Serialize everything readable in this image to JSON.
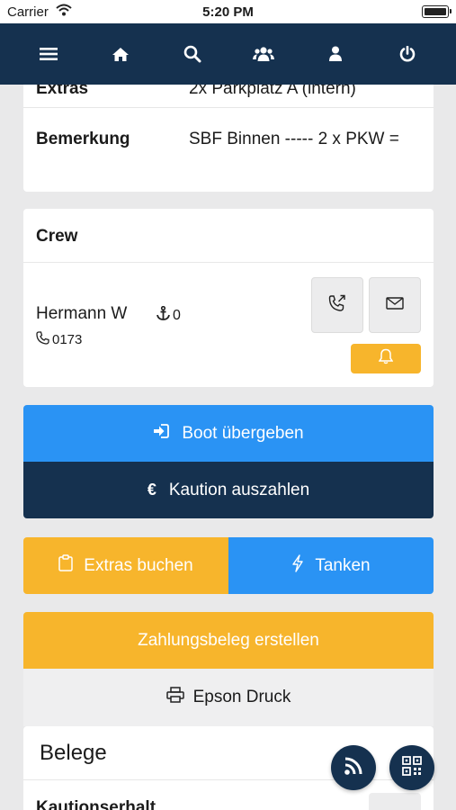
{
  "status": {
    "carrier": "Carrier",
    "time": "5:20 PM"
  },
  "navbar": {
    "items": [
      {
        "icon": "menu-icon"
      },
      {
        "icon": "home-icon"
      },
      {
        "icon": "search-icon"
      },
      {
        "icon": "users-icon"
      },
      {
        "icon": "user-icon"
      },
      {
        "icon": "power-icon"
      }
    ]
  },
  "details": {
    "extras_label": "Extras",
    "extras_value": "2x Parkplatz A (intern)",
    "bemerkung_label": "Bemerkung",
    "bemerkung_value": "SBF Binnen ----- 2 x PKW ="
  },
  "crew": {
    "title": "Crew",
    "member_name": "Hermann W",
    "anchor_count": "0",
    "phone": "0173"
  },
  "actions": {
    "boot_uebergeben": "Boot übergeben",
    "kaution_auszahlen": "Kaution auszahlen",
    "extras_buchen": "Extras buchen",
    "tanken": "Tanken",
    "zahlungsbeleg": "Zahlungsbeleg erstellen",
    "epson_druck": "Epson Druck"
  },
  "belege": {
    "title": "Belege",
    "kaution_label": "Kautionserhalt"
  },
  "colors": {
    "navy": "#15314f",
    "blue": "#2a93f4",
    "yellow": "#f7b52c",
    "background": "#e9e9ea"
  }
}
